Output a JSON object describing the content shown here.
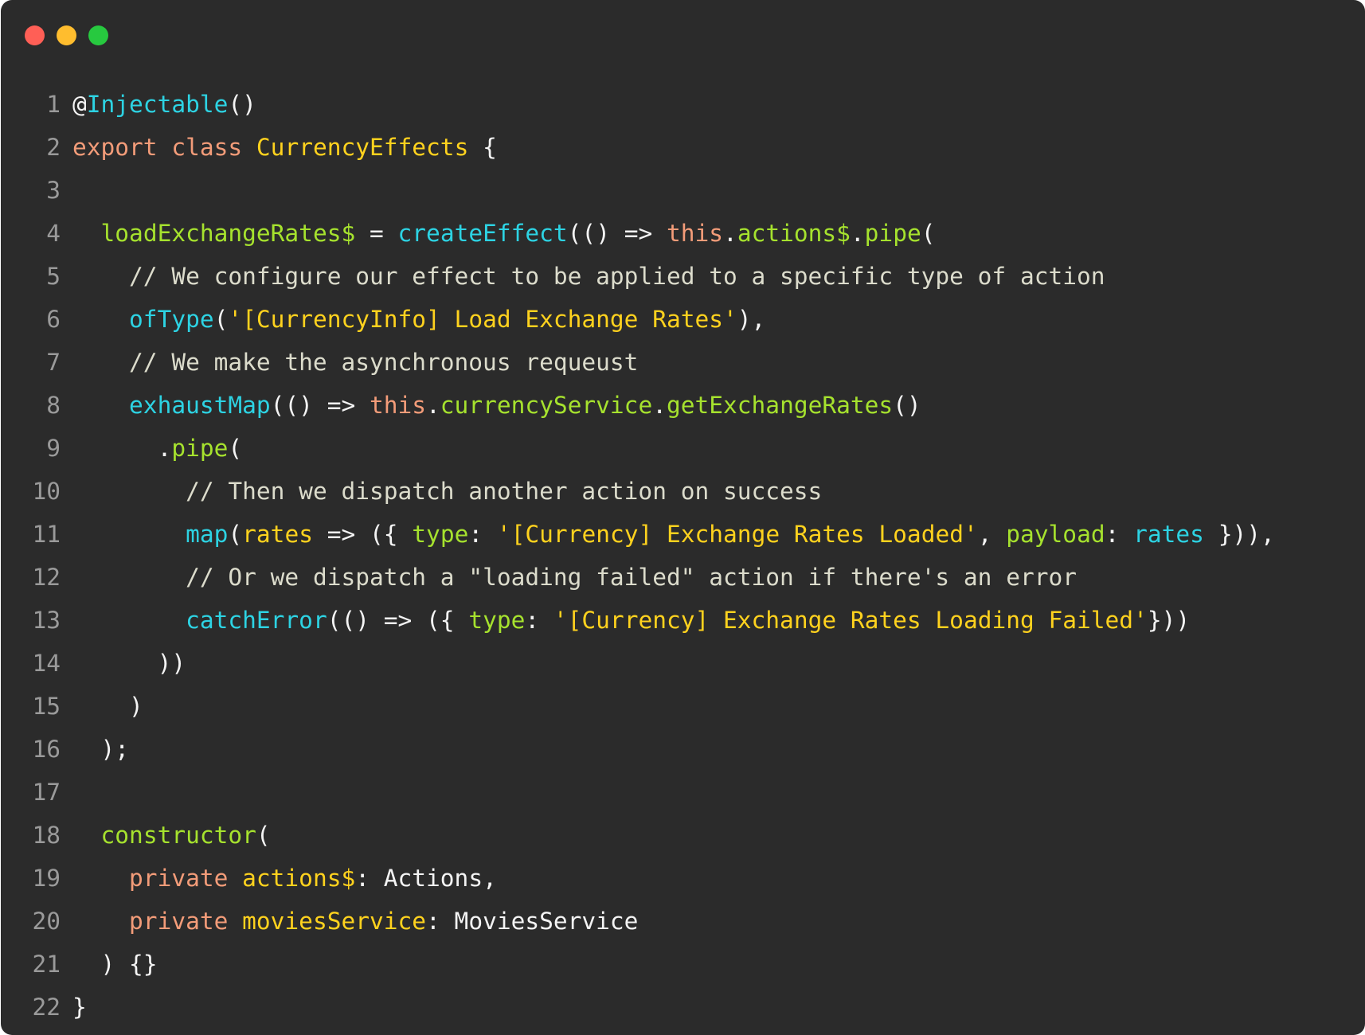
{
  "window": {
    "controls": [
      {
        "name": "close",
        "color": "#ff5f56"
      },
      {
        "name": "minimize",
        "color": "#ffbd2e"
      },
      {
        "name": "maximize",
        "color": "#27c93f"
      }
    ]
  },
  "colors": {
    "background": "#2b2b2b",
    "line_number": "#9a9a9a",
    "plain": "#f4f4f4",
    "keyword": "#f39c79",
    "class_name": "#ffd21e",
    "function": "#2dd3e3",
    "property": "#a6e22e",
    "string": "#ffd21e",
    "comment": "#dcdccc"
  },
  "code": {
    "language": "typescript",
    "lines": [
      {
        "number": "1",
        "tokens": [
          {
            "t": "@",
            "k": "plain"
          },
          {
            "t": "Injectable",
            "k": "function"
          },
          {
            "t": "()",
            "k": "plain"
          }
        ]
      },
      {
        "number": "2",
        "tokens": [
          {
            "t": "export",
            "k": "keyword"
          },
          {
            "t": " ",
            "k": "plain"
          },
          {
            "t": "class",
            "k": "keyword"
          },
          {
            "t": " ",
            "k": "plain"
          },
          {
            "t": "CurrencyEffects",
            "k": "class_name"
          },
          {
            "t": " {",
            "k": "plain"
          }
        ]
      },
      {
        "number": "3",
        "tokens": []
      },
      {
        "number": "4",
        "tokens": [
          {
            "t": "  ",
            "k": "plain"
          },
          {
            "t": "loadExchangeRates$",
            "k": "property"
          },
          {
            "t": " = ",
            "k": "plain"
          },
          {
            "t": "createEffect",
            "k": "function"
          },
          {
            "t": "(() => ",
            "k": "plain"
          },
          {
            "t": "this",
            "k": "keyword"
          },
          {
            "t": ".",
            "k": "plain"
          },
          {
            "t": "actions$",
            "k": "property"
          },
          {
            "t": ".",
            "k": "plain"
          },
          {
            "t": "pipe",
            "k": "property"
          },
          {
            "t": "(",
            "k": "plain"
          }
        ]
      },
      {
        "number": "5",
        "tokens": [
          {
            "t": "    ",
            "k": "plain"
          },
          {
            "t": "// We configure our effect to be applied to a specific type of action",
            "k": "comment"
          }
        ]
      },
      {
        "number": "6",
        "tokens": [
          {
            "t": "    ",
            "k": "plain"
          },
          {
            "t": "ofType",
            "k": "function"
          },
          {
            "t": "(",
            "k": "plain"
          },
          {
            "t": "'[CurrencyInfo] Load Exchange Rates'",
            "k": "string"
          },
          {
            "t": "),",
            "k": "plain"
          }
        ]
      },
      {
        "number": "7",
        "tokens": [
          {
            "t": "    ",
            "k": "plain"
          },
          {
            "t": "// We make the asynchronous requeust",
            "k": "comment"
          }
        ]
      },
      {
        "number": "8",
        "tokens": [
          {
            "t": "    ",
            "k": "plain"
          },
          {
            "t": "exhaustMap",
            "k": "function"
          },
          {
            "t": "(() => ",
            "k": "plain"
          },
          {
            "t": "this",
            "k": "keyword"
          },
          {
            "t": ".",
            "k": "plain"
          },
          {
            "t": "currencyService",
            "k": "property"
          },
          {
            "t": ".",
            "k": "plain"
          },
          {
            "t": "getExchangeRates",
            "k": "property"
          },
          {
            "t": "()",
            "k": "plain"
          }
        ]
      },
      {
        "number": "9",
        "tokens": [
          {
            "t": "      .",
            "k": "plain"
          },
          {
            "t": "pipe",
            "k": "property"
          },
          {
            "t": "(",
            "k": "plain"
          }
        ]
      },
      {
        "number": "10",
        "tokens": [
          {
            "t": "        ",
            "k": "plain"
          },
          {
            "t": "// Then we dispatch another action on success",
            "k": "comment"
          }
        ]
      },
      {
        "number": "11",
        "tokens": [
          {
            "t": "        ",
            "k": "plain"
          },
          {
            "t": "map",
            "k": "function"
          },
          {
            "t": "(",
            "k": "plain"
          },
          {
            "t": "rates",
            "k": "class_name"
          },
          {
            "t": " => ({ ",
            "k": "plain"
          },
          {
            "t": "type",
            "k": "property"
          },
          {
            "t": ": ",
            "k": "plain"
          },
          {
            "t": "'[Currency] Exchange Rates Loaded'",
            "k": "string"
          },
          {
            "t": ", ",
            "k": "plain"
          },
          {
            "t": "payload",
            "k": "property"
          },
          {
            "t": ": ",
            "k": "plain"
          },
          {
            "t": "rates",
            "k": "function"
          },
          {
            "t": " })),",
            "k": "plain"
          }
        ]
      },
      {
        "number": "12",
        "tokens": [
          {
            "t": "        ",
            "k": "plain"
          },
          {
            "t": "// Or we dispatch a \"loading failed\" action if there's an error",
            "k": "comment"
          }
        ]
      },
      {
        "number": "13",
        "tokens": [
          {
            "t": "        ",
            "k": "plain"
          },
          {
            "t": "catchError",
            "k": "function"
          },
          {
            "t": "(() => ({ ",
            "k": "plain"
          },
          {
            "t": "type",
            "k": "property"
          },
          {
            "t": ": ",
            "k": "plain"
          },
          {
            "t": "'[Currency] Exchange Rates Loading Failed'",
            "k": "string"
          },
          {
            "t": "}))",
            "k": "plain"
          }
        ]
      },
      {
        "number": "14",
        "tokens": [
          {
            "t": "      ))",
            "k": "plain"
          }
        ]
      },
      {
        "number": "15",
        "tokens": [
          {
            "t": "    )",
            "k": "plain"
          }
        ]
      },
      {
        "number": "16",
        "tokens": [
          {
            "t": "  );",
            "k": "plain"
          }
        ]
      },
      {
        "number": "17",
        "tokens": []
      },
      {
        "number": "18",
        "tokens": [
          {
            "t": "  ",
            "k": "plain"
          },
          {
            "t": "constructor",
            "k": "property"
          },
          {
            "t": "(",
            "k": "plain"
          }
        ]
      },
      {
        "number": "19",
        "tokens": [
          {
            "t": "    ",
            "k": "plain"
          },
          {
            "t": "private",
            "k": "keyword"
          },
          {
            "t": " ",
            "k": "plain"
          },
          {
            "t": "actions$",
            "k": "class_name"
          },
          {
            "t": ": Actions,",
            "k": "plain"
          }
        ]
      },
      {
        "number": "20",
        "tokens": [
          {
            "t": "    ",
            "k": "plain"
          },
          {
            "t": "private",
            "k": "keyword"
          },
          {
            "t": " ",
            "k": "plain"
          },
          {
            "t": "moviesService",
            "k": "class_name"
          },
          {
            "t": ": MoviesService",
            "k": "plain"
          }
        ]
      },
      {
        "number": "21",
        "tokens": [
          {
            "t": "  ) {}",
            "k": "plain"
          }
        ]
      },
      {
        "number": "22",
        "tokens": [
          {
            "t": "}",
            "k": "plain"
          }
        ]
      }
    ]
  }
}
